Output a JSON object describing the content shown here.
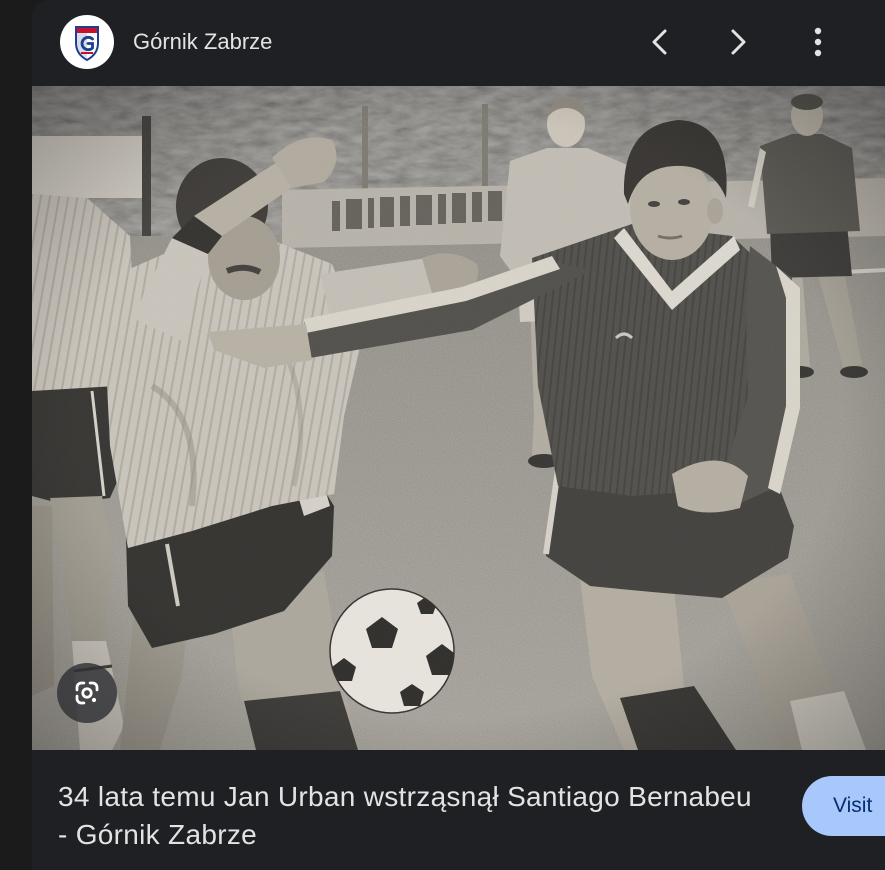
{
  "source": {
    "name": "Górnik Zabrze",
    "logo_icon": "gornik-zabrze-crest-icon"
  },
  "nav": {
    "previous_icon": "chevron-left-icon",
    "next_icon": "chevron-right-icon",
    "more_icon": "more-vert-icon"
  },
  "image": {
    "lens_icon": "google-lens-icon"
  },
  "caption": {
    "lines": [
      "34 lata temu Jan Urban wstrząsnął Santiago Bernabeu",
      "- Górnik Zabrze"
    ]
  },
  "visit_button": {
    "label": "Visit"
  },
  "colors": {
    "page_background": "#1b1b1c",
    "panel_background": "#1f2023",
    "text": "#e3e3e3",
    "icon": "#e3e3e3",
    "visit_button_background": "#a8c7fa",
    "visit_button_text": "#062e6f"
  }
}
